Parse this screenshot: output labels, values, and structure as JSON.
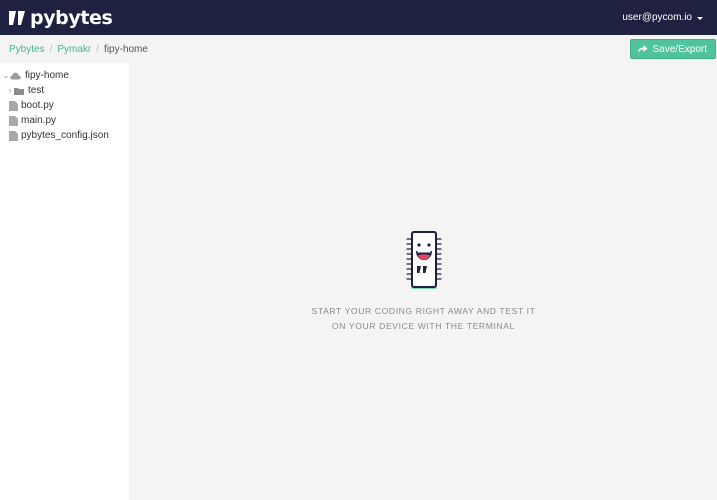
{
  "header": {
    "logo_text": "pybytes",
    "user_email": "user@pycom.io"
  },
  "breadcrumb": {
    "items": [
      "Pybytes",
      "Pymakr"
    ],
    "current": "fipy-home"
  },
  "toolbar": {
    "save_label": "Save/Export"
  },
  "file_tree": {
    "root": "fipy-home",
    "folders": [
      "test"
    ],
    "files": [
      "boot.py",
      "main.py",
      "pybytes_config.json"
    ]
  },
  "empty_state": {
    "line1": "START YOUR CODING RIGHT AWAY AND TEST IT",
    "line2": "ON YOUR DEVICE WITH THE TERMINAL"
  },
  "colors": {
    "header_bg": "#1f2140",
    "accent": "#4fc39b",
    "link": "#44b591"
  }
}
